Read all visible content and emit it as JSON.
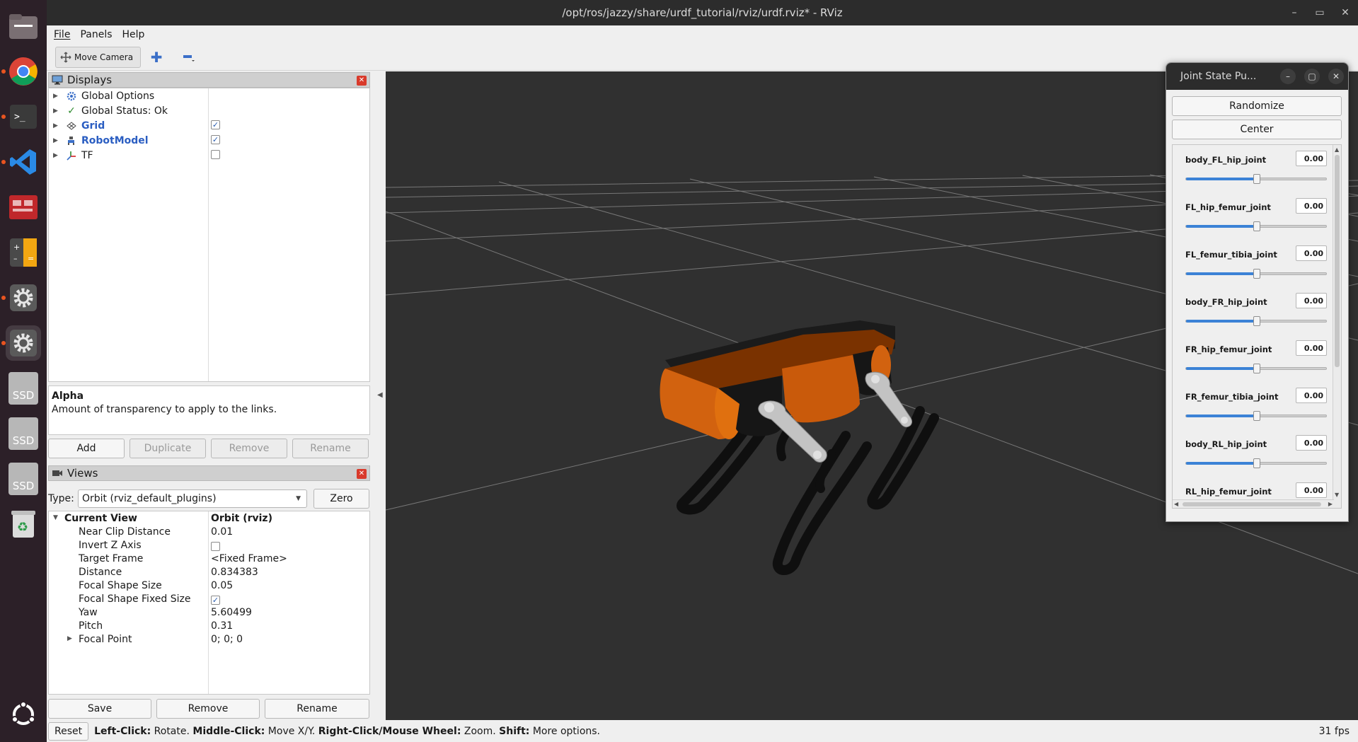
{
  "window": {
    "title": "/opt/ros/jazzy/share/urdf_tutorial/rviz/urdf.rviz* - RViz",
    "controls": [
      "–",
      "▭",
      "✕"
    ]
  },
  "dock": {
    "items": [
      "files-icon",
      "chrome-icon",
      "terminal-icon",
      "vscode-icon",
      "app-icon",
      "calculator-icon",
      "settings-icon",
      "settings-icon-2",
      "ssd-1",
      "ssd-2",
      "ssd-3",
      "trash-icon"
    ],
    "ssd_label": "SSD"
  },
  "menu": [
    "File",
    "Panels",
    "Help"
  ],
  "toolbar": {
    "move_camera": "Move Camera"
  },
  "displays": {
    "title": "Displays",
    "items": [
      {
        "label": "Global Options",
        "checked": null,
        "bold": false
      },
      {
        "label": "Global Status: Ok",
        "checked": null,
        "bold": false
      },
      {
        "label": "Grid",
        "checked": true,
        "bold": true
      },
      {
        "label": "RobotModel",
        "checked": true,
        "bold": true
      },
      {
        "label": "TF",
        "checked": false,
        "bold": false
      }
    ],
    "check_mark": "✓",
    "description_title": "Alpha",
    "description_text": "Amount of transparency to apply to the links.",
    "buttons": {
      "add": "Add",
      "duplicate": "Duplicate",
      "remove": "Remove",
      "rename": "Rename"
    }
  },
  "views": {
    "title": "Views",
    "type_label": "Type:",
    "type_value": "Orbit (rviz_default_plugins)",
    "zero": "Zero",
    "current_view": {
      "key": "Current View",
      "value": "Orbit (rviz)"
    },
    "props": [
      {
        "key": "Near Clip Distance",
        "value": "0.01"
      },
      {
        "key": "Invert Z Axis",
        "value": "",
        "checkbox": false
      },
      {
        "key": "Target Frame",
        "value": "<Fixed Frame>"
      },
      {
        "key": "Distance",
        "value": "0.834383"
      },
      {
        "key": "Focal Shape Size",
        "value": "0.05"
      },
      {
        "key": "Focal Shape Fixed Size",
        "value": "",
        "checkbox": true
      },
      {
        "key": "Yaw",
        "value": "5.60499"
      },
      {
        "key": "Pitch",
        "value": "0.31"
      },
      {
        "key": "Focal Point",
        "value": "0; 0; 0"
      }
    ],
    "buttons": {
      "save": "Save",
      "remove": "Remove",
      "rename": "Rename"
    }
  },
  "status": {
    "reset": "Reset",
    "hints": [
      {
        "key": "Left-Click:",
        "text": " Rotate. "
      },
      {
        "key": "Middle-Click:",
        "text": " Move X/Y. "
      },
      {
        "key": "Right-Click/Mouse Wheel:",
        "text": " Zoom. "
      },
      {
        "key": "Shift:",
        "text": " More options."
      }
    ],
    "fps": "31 fps"
  },
  "jsp": {
    "title": "Joint State Pu...",
    "randomize": "Randomize",
    "center": "Center",
    "joints": [
      {
        "name": "body_FL_hip_joint",
        "value": "0.00",
        "level": 0.5
      },
      {
        "name": "FL_hip_femur_joint",
        "value": "0.00",
        "level": 0.5
      },
      {
        "name": "FL_femur_tibia_joint",
        "value": "0.00",
        "level": 0.5
      },
      {
        "name": "body_FR_hip_joint",
        "value": "0.00",
        "level": 0.5
      },
      {
        "name": "FR_hip_femur_joint",
        "value": "0.00",
        "level": 0.5
      },
      {
        "name": "FR_femur_tibia_joint",
        "value": "0.00",
        "level": 0.5
      },
      {
        "name": "body_RL_hip_joint",
        "value": "0.00",
        "level": 0.5
      },
      {
        "name": "RL_hip_femur_joint",
        "value": "0.00",
        "level": 0.5
      }
    ]
  }
}
